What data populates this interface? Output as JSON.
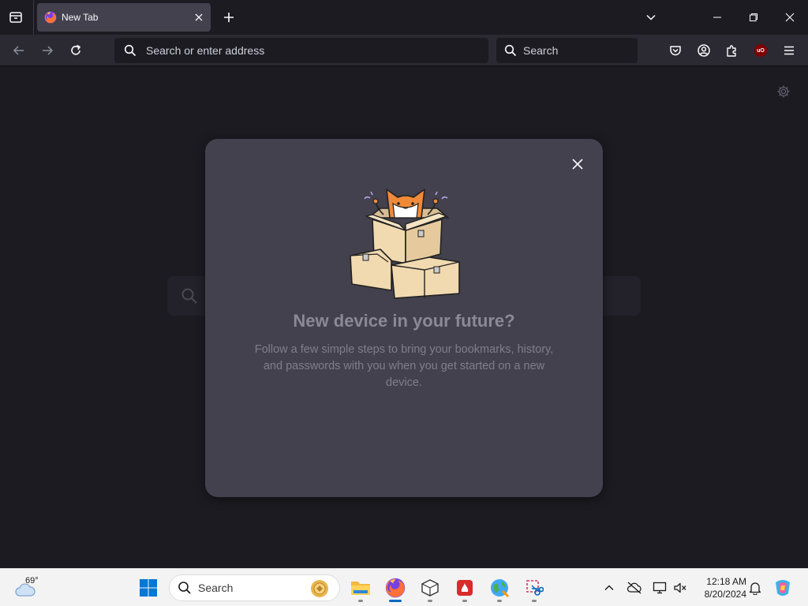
{
  "browser": {
    "tab": {
      "title": "New Tab"
    },
    "urlbar": {
      "placeholder": "Search or enter address"
    },
    "searchbar": {
      "placeholder": "Search"
    },
    "toolbar_icons": [
      "pocket-icon",
      "account-icon",
      "extensions-icon",
      "ublock-origin-icon",
      "menu-icon"
    ],
    "ublock_badge_text": "uO"
  },
  "modal": {
    "title": "New device in your future?",
    "body": "Follow a few simple steps to bring your bookmarks, history, and passwords with you when you get started on a new device."
  },
  "taskbar": {
    "weather": {
      "temperature": "69°"
    },
    "search": {
      "label": "Search"
    },
    "apps": [
      "windows-start-icon",
      "file-explorer-icon",
      "firefox-icon",
      "box-app-icon",
      "red-app-icon",
      "globe-app-icon",
      "snipping-tool-icon"
    ],
    "clock": {
      "time": "12:18 AM",
      "date": "8/20/2024"
    }
  },
  "colors": {
    "chrome_dark": "#1c1b22",
    "toolbar": "#2b2a33",
    "tab_selected": "#42414d",
    "modal_bg": "#42414d",
    "taskbar_bg": "#f3f3f3",
    "accent_blue": "#0067c0"
  }
}
